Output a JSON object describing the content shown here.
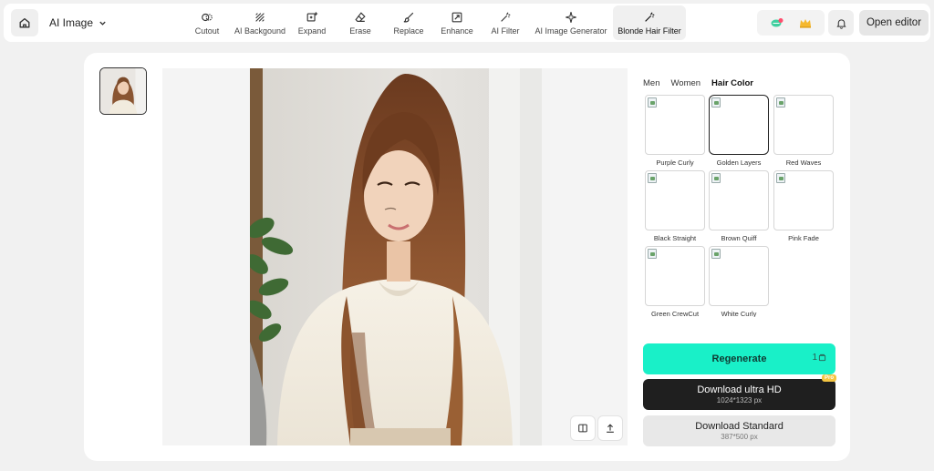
{
  "header": {
    "app_name": "AI Image",
    "tools": [
      {
        "label": "Cutout",
        "icon": "cutout-icon"
      },
      {
        "label": "AI Backgound",
        "icon": "background-icon"
      },
      {
        "label": "Expand",
        "icon": "expand-icon"
      },
      {
        "label": "Erase",
        "icon": "eraser-icon"
      },
      {
        "label": "Replace",
        "icon": "brush-icon"
      },
      {
        "label": "Enhance",
        "icon": "enhance-icon"
      },
      {
        "label": "AI Filter",
        "icon": "magic-wand-icon"
      },
      {
        "label": "AI Image Generator",
        "icon": "sparkle-icon"
      },
      {
        "label": "Blonde Hair Filter",
        "icon": "magic-wand-icon",
        "active": true
      }
    ],
    "open_editor_label": "Open editor"
  },
  "panel": {
    "tabs": [
      {
        "label": "Men",
        "active": false
      },
      {
        "label": "Women",
        "active": false
      },
      {
        "label": "Hair Color",
        "active": true
      }
    ],
    "styles": [
      {
        "label": "Purple Curly",
        "selected": false
      },
      {
        "label": "Golden Layers",
        "selected": true
      },
      {
        "label": "Red Waves",
        "selected": false
      },
      {
        "label": "Black Straight",
        "selected": false
      },
      {
        "label": "Brown Quiff",
        "selected": false
      },
      {
        "label": "Pink Fade",
        "selected": false
      },
      {
        "label": "Green CrewCut",
        "selected": false
      },
      {
        "label": "White Curly",
        "selected": false
      }
    ],
    "regenerate_label": "Regenerate",
    "regenerate_cost": "1",
    "download_hd_label": "Download ultra HD",
    "download_hd_size": "1024*1323 px",
    "pro_badge": "Pro",
    "download_std_label": "Download Standard",
    "download_std_size": "387*500 px"
  },
  "colors": {
    "accent": "#19f0c8",
    "dark_button": "#1f1f1f",
    "pro_badge": "#f4c542"
  }
}
